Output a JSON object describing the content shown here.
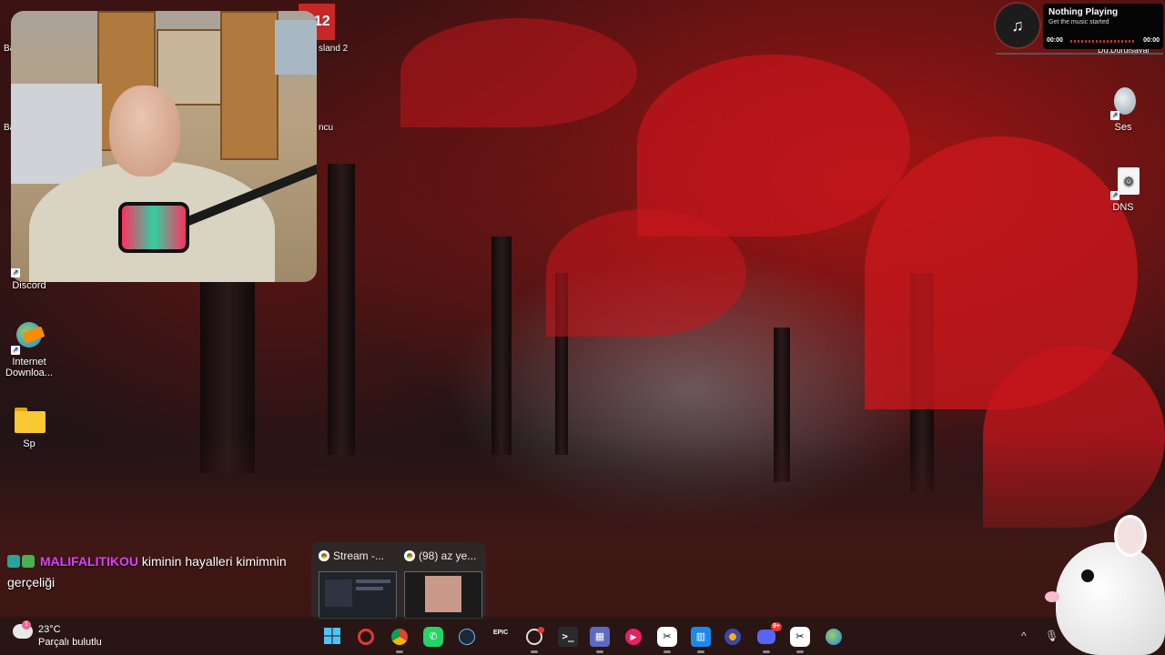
{
  "desktop_icons": [
    {
      "label": "Discord",
      "icon": "discord-icon"
    },
    {
      "label": "Internet Downloa...",
      "icon": "internet-download-manager-icon"
    },
    {
      "label": "Sp",
      "icon": "folder-icon"
    },
    {
      "label": "Ses",
      "icon": "speaker-icon"
    },
    {
      "label": "DNS",
      "icon": "dns-settings-icon"
    }
  ],
  "partial_labels": {
    "ba_top": "Ba",
    "ba_mid": "Ba",
    "island": "sland 2",
    "ncu": "ncu",
    "duraksayar": "Du.Durqlsayar"
  },
  "music_widget": {
    "title": "Nothing Playing",
    "subtitle": "Get the music started",
    "time_start": "00:00",
    "time_end": "00:00",
    "icon": "music-note-icon"
  },
  "chat": {
    "username": "MALIFALITIKOU",
    "message_line1": "kiminin hayalleri kimimnin",
    "message_line2": "gerçeliği"
  },
  "thumbnails": [
    {
      "title": "Stream -...",
      "app": "chrome-icon"
    },
    {
      "title": "(98) az ye...",
      "app": "chrome-icon"
    }
  ],
  "weather": {
    "temperature": "23°C",
    "description": "Parçalı bulutlu",
    "badge": "1"
  },
  "taskbar": {
    "apps": [
      {
        "name": "start-button",
        "label": ""
      },
      {
        "name": "opera-gx-icon",
        "label": ""
      },
      {
        "name": "chrome-icon",
        "label": ""
      },
      {
        "name": "whatsapp-icon",
        "label": ""
      },
      {
        "name": "steam-icon",
        "label": ""
      },
      {
        "name": "epic-games-icon",
        "label": "EPIC"
      },
      {
        "name": "obs-icon",
        "label": ""
      },
      {
        "name": "terminal-icon",
        "label": ""
      },
      {
        "name": "calculator-icon",
        "label": ""
      },
      {
        "name": "media-player-icon",
        "label": ""
      },
      {
        "name": "capcut-icon",
        "label": ""
      },
      {
        "name": "store-icon",
        "label": ""
      },
      {
        "name": "game-icon",
        "label": ""
      },
      {
        "name": "discord-icon",
        "label": "9+"
      },
      {
        "name": "capcut-icon-2",
        "label": ""
      },
      {
        "name": "idm-icon",
        "label": ""
      }
    ]
  },
  "colors": {
    "chat_username": "#e040fb",
    "music_bar": "#b33333",
    "taskbar_bg": "#191616"
  }
}
